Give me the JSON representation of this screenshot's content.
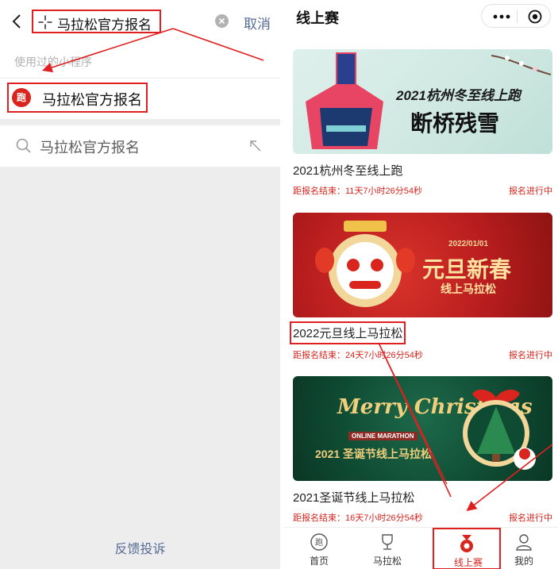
{
  "left": {
    "search_value": "马拉松官方报名",
    "cancel_label": "取消",
    "recent_title": "使用过的小程序",
    "recent_item": {
      "logo_text": "跑",
      "label": "马拉松官方报名"
    },
    "suggestion": "马拉松官方报名",
    "feedback_label": "反馈投诉"
  },
  "right": {
    "title": "线上赛",
    "races": [
      {
        "name": "2021杭州冬至线上跑",
        "countdown": "距报名结束：11天7小时26分54秒",
        "status": "报名进行中",
        "banner_title_1": "2021杭州冬至线上跑",
        "banner_title_2": "断桥残雪"
      },
      {
        "name": "2022元旦线上马拉松",
        "countdown": "距报名结束：24天7小时26分54秒",
        "status": "报名进行中",
        "banner_date": "2022/01/01",
        "banner_title_1": "元旦新春",
        "banner_title_2": "线上马拉松"
      },
      {
        "name": "2021圣诞节线上马拉松",
        "countdown": "距报名结束：16天7小时26分54秒",
        "status": "报名进行中",
        "banner_title_1": "Merry Christmas",
        "banner_sub": "ONLINE MARATHON",
        "banner_title_2": "2021 圣诞节线上马拉松"
      }
    ],
    "tabs": [
      {
        "label": "首页",
        "icon": "home-logo-icon"
      },
      {
        "label": "马拉松",
        "icon": "trophy-icon"
      },
      {
        "label": "线上赛",
        "icon": "medal-icon"
      },
      {
        "label": "我的",
        "icon": "user-icon"
      }
    ]
  },
  "colors": {
    "annotation_red": "#e02020",
    "link_blue": "#576b95",
    "brand_red": "#d9251d"
  }
}
